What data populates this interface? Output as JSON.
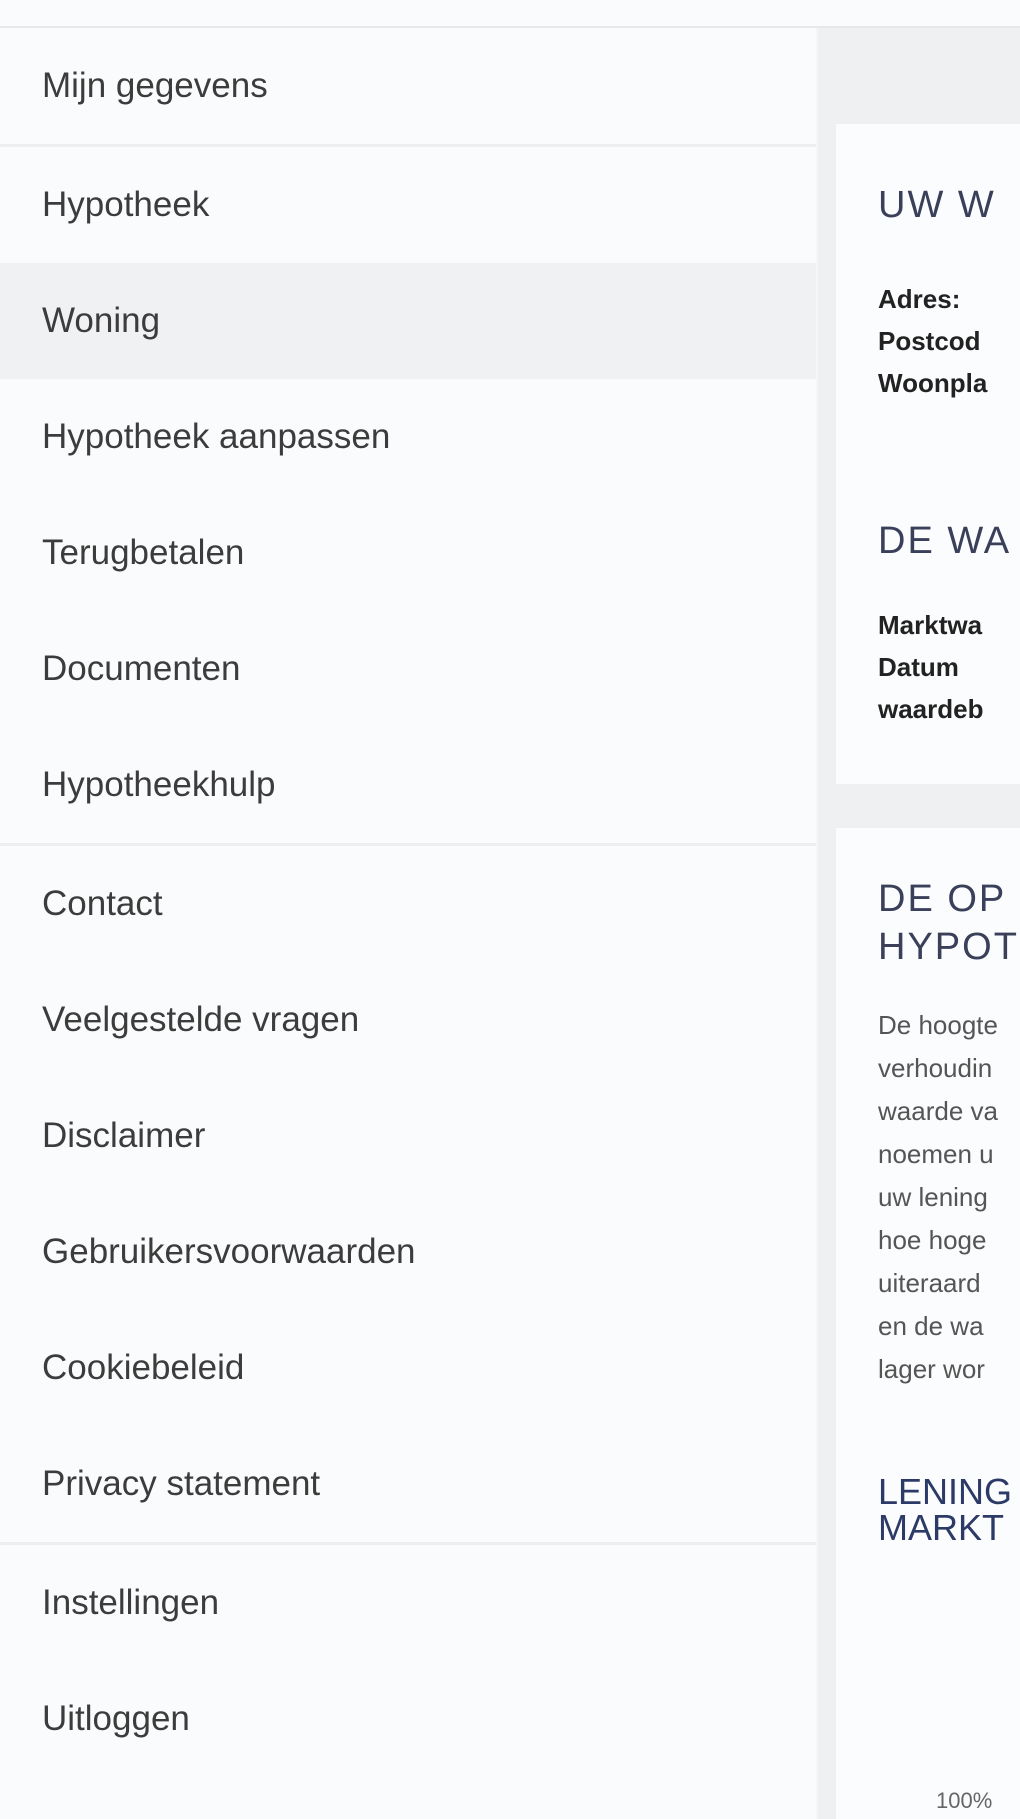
{
  "nav": {
    "group1": [
      {
        "label": "Mijn gegevens"
      }
    ],
    "group2": [
      {
        "label": "Hypotheek"
      },
      {
        "label": "Woning"
      },
      {
        "label": "Hypotheek aanpassen"
      },
      {
        "label": "Terugbetalen"
      },
      {
        "label": "Documenten"
      },
      {
        "label": "Hypotheekhulp"
      }
    ],
    "group3": [
      {
        "label": "Contact"
      },
      {
        "label": "Veelgestelde vragen"
      },
      {
        "label": "Disclaimer"
      },
      {
        "label": "Gebruikersvoorwaarden"
      },
      {
        "label": "Cookiebeleid"
      },
      {
        "label": "Privacy statement"
      }
    ],
    "group4": [
      {
        "label": "Instellingen"
      },
      {
        "label": "Uitloggen"
      }
    ],
    "active": "Woning"
  },
  "content": {
    "card1": {
      "heading": "UW W",
      "labels": [
        "Adres:",
        "Postcod",
        "Woonpla"
      ],
      "heading2": "DE WA",
      "labels2": [
        "Marktwa",
        "Datum",
        "waardeb"
      ]
    },
    "card2": {
      "heading_line1": "DE OP",
      "heading_line2": "HYPOT",
      "paragraph_lines": [
        "De hoogte",
        "verhoudin",
        "waarde va",
        "noemen u",
        "uw lening",
        "hoe hoge",
        "uiteraard",
        "en de wa",
        "lager wor"
      ],
      "subheading_line1": "LENING",
      "subheading_line2": "MARKT",
      "axis_label": "100%"
    }
  },
  "colors": {
    "sidebar_bg": "#fafbfc",
    "active_bg": "#f0f1f2",
    "content_bg": "#eef0f2",
    "heading_navy": "#2c3a67"
  }
}
